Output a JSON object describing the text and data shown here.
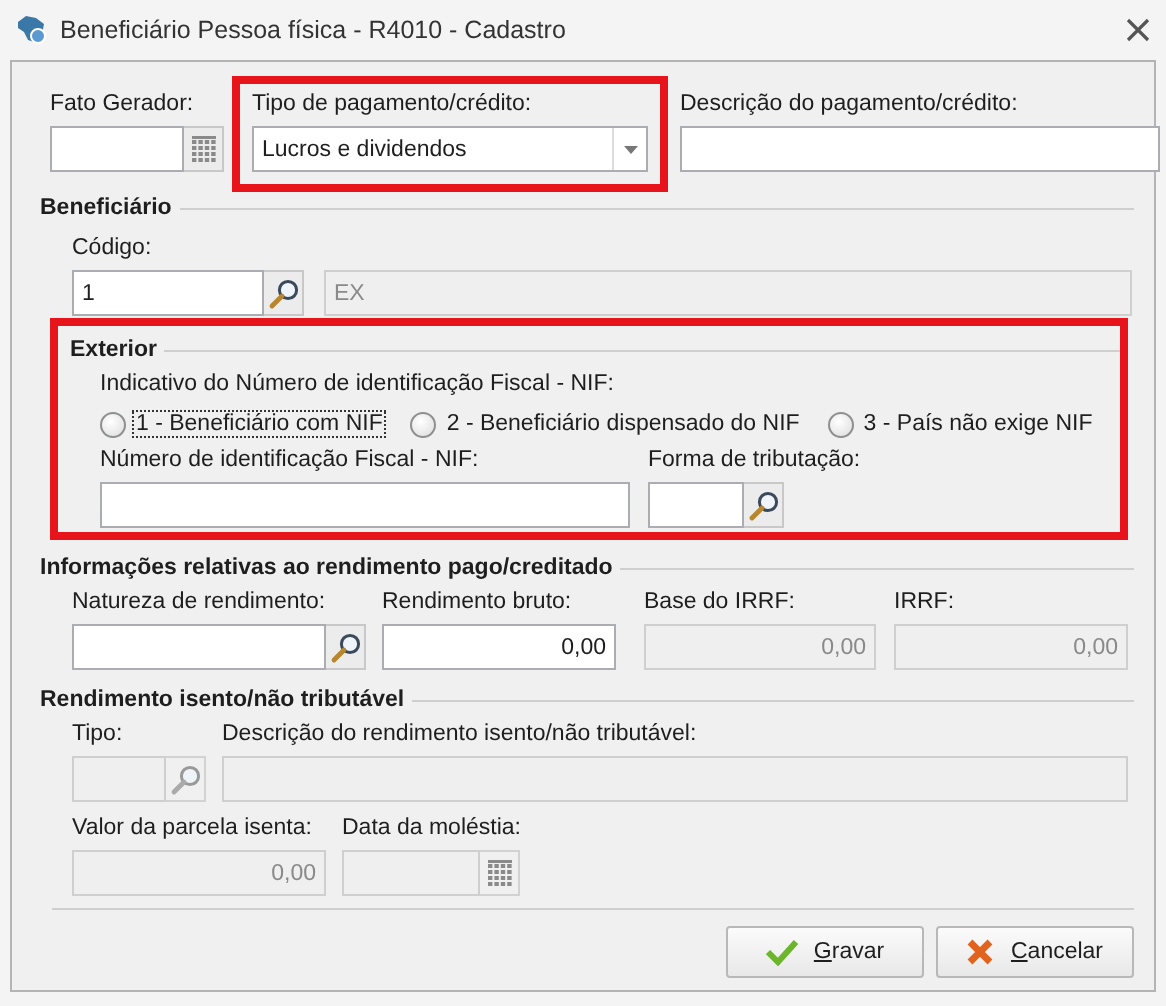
{
  "window": {
    "title": "Beneficiário Pessoa física - R4010 - Cadastro"
  },
  "top_fields": [
    {
      "label": "Fato Gerador:",
      "kind": "date",
      "disabled": false,
      "highlighted": false
    },
    {
      "label": "Tipo de pagamento/crédito:",
      "kind": "combo",
      "value": "Lucros e dividendos",
      "disabled": false,
      "highlighted": true
    },
    {
      "label": "Descrição do pagamento/crédito:",
      "kind": "text",
      "disabled": false,
      "highlighted": false
    }
  ],
  "beneficiario": {
    "title": "Beneficiário",
    "fields": [
      {
        "label": "Código:",
        "kind": "lookup",
        "value": "1",
        "disabled": false
      },
      {
        "kind": "text",
        "value": "EX",
        "disabled": true
      }
    ]
  },
  "exterior": {
    "title": "Exterior",
    "highlighted": true,
    "nif_indicator": {
      "label": "Indicativo do Número de identificação Fiscal - NIF:",
      "options": [
        {
          "label": "1 - Beneficiário com NIF",
          "selected": false,
          "focused": true
        },
        {
          "label": "2 - Beneficiário dispensado do NIF",
          "selected": false,
          "focused": false
        },
        {
          "label": "3 - País não exige NIF",
          "selected": false,
          "focused": false
        }
      ]
    },
    "fields": [
      {
        "label": "Número de identificação Fiscal - NIF:",
        "kind": "text",
        "disabled": false
      },
      {
        "label": "Forma de tributação:",
        "kind": "lookup",
        "disabled": false
      }
    ]
  },
  "rendimento": {
    "title": "Informações relativas ao rendimento pago/creditado",
    "fields": [
      {
        "label": "Natureza de rendimento:",
        "kind": "lookup",
        "disabled": false
      },
      {
        "label": "Rendimento bruto:",
        "kind": "number",
        "value": "0,00",
        "disabled": false
      },
      {
        "label": "Base do IRRF:",
        "kind": "number",
        "value": "0,00",
        "disabled": true
      },
      {
        "label": "IRRF:",
        "kind": "number",
        "value": "0,00",
        "disabled": true
      }
    ]
  },
  "isento": {
    "title": "Rendimento isento/não tributável",
    "rows": [
      [
        {
          "label": "Tipo:",
          "kind": "lookup",
          "disabled": true
        },
        {
          "label": "Descrição do rendimento isento/não tributável:",
          "kind": "text",
          "disabled": true
        }
      ],
      [
        {
          "label": "Valor da parcela isenta:",
          "kind": "number",
          "value": "0,00",
          "disabled": true
        },
        {
          "label": "Data da moléstia:",
          "kind": "date",
          "disabled": true
        }
      ]
    ]
  },
  "buttons": [
    {
      "label": "Gravar",
      "kind": "save"
    },
    {
      "label": "Cancelar",
      "kind": "cancel"
    }
  ]
}
